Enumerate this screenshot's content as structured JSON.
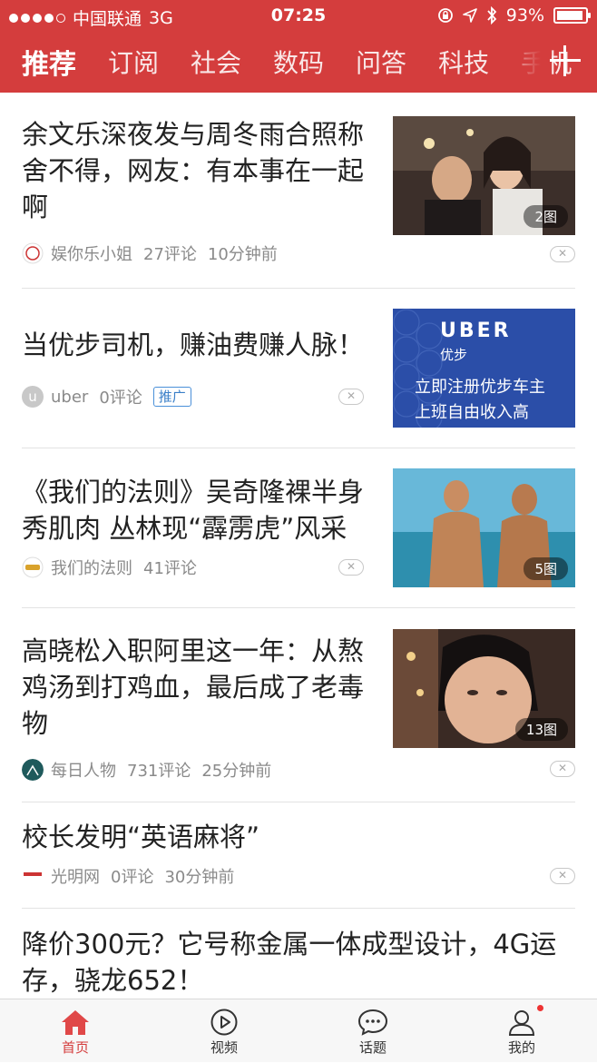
{
  "status_bar": {
    "carrier": "中国联通",
    "network": "3G",
    "time": "07:25",
    "battery": "93%",
    "battery_level": 0.93
  },
  "nav": {
    "tabs": [
      "推荐",
      "订阅",
      "社会",
      "数码",
      "问答",
      "科技",
      "手机"
    ],
    "active_index": 0,
    "add_icon": "plus-icon",
    "accent_color": "#d43d3d"
  },
  "articles": [
    {
      "title": "余文乐深夜发与周冬雨合照称舍不得，网友：有本事在一起啊",
      "source": "娱你乐小姐",
      "comments": "27评论",
      "time": "10分钟前",
      "image_badge": "2图"
    },
    {
      "title": "当优步司机，赚油费赚人脉！",
      "source": "uber",
      "comments": "0评论",
      "tag": "推广",
      "ad_image": {
        "brand": "UBER",
        "brand_cn": "优步",
        "line1": "立即注册优步车主",
        "line2": "上班自由收入高"
      }
    },
    {
      "title": "《我们的法则》吴奇隆裸半身秀肌肉 丛林现“霹雳虎”风采",
      "source": "我们的法则",
      "comments": "41评论",
      "image_badge": "5图"
    },
    {
      "title": "高晓松入职阿里这一年：从熬鸡汤到打鸡血，最后成了老毒物",
      "source": "每日人物",
      "comments": "731评论",
      "time": "25分钟前",
      "image_badge": "13图"
    },
    {
      "title": "校长发明“英语麻将”",
      "source": "光明网",
      "comments": "0评论",
      "time": "30分钟前"
    },
    {
      "title": "降价300元？它号称金属一体成型设计，4G运存，骁龙652！"
    }
  ],
  "tab_bar": {
    "items": [
      {
        "label": "首页",
        "icon": "home-icon"
      },
      {
        "label": "视频",
        "icon": "play-icon"
      },
      {
        "label": "话题",
        "icon": "chat-bubble-icon"
      },
      {
        "label": "我的",
        "icon": "person-icon"
      }
    ],
    "active_index": 0
  }
}
